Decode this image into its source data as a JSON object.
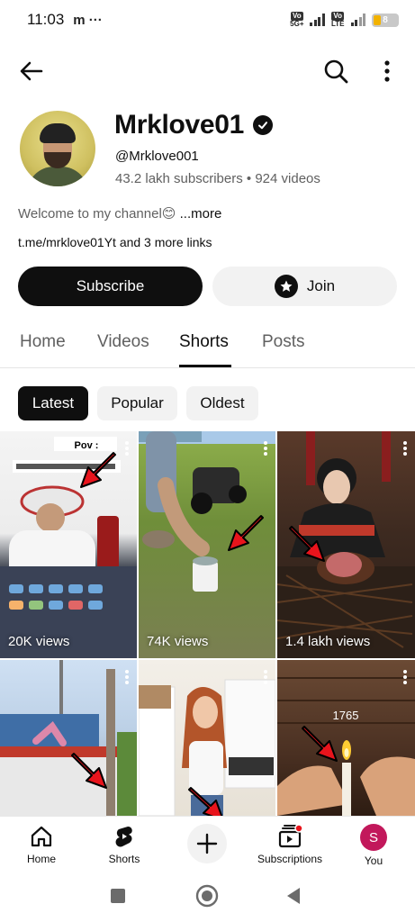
{
  "status_bar": {
    "time": "11:03",
    "left_icons": [
      "messaging-m-icon",
      "more-dots-icon"
    ],
    "left_text": "m ···",
    "network": [
      {
        "top": "Vo",
        "bottom": "5G+"
      },
      {
        "top": "Vo",
        "bottom": "LTE"
      }
    ],
    "battery": "8"
  },
  "appbar": {
    "back_icon": "back-arrow-icon",
    "search_icon": "search-icon",
    "more_icon": "more-vert-icon"
  },
  "channel": {
    "name": "Mrklove01",
    "handle": "@Mrklove001",
    "meta": "43.2 lakh subscribers • 924 videos",
    "description": "Welcome to my channel😊 ",
    "more": "...more",
    "links": "t.me/mrklove01Yt and 3 more links",
    "subscribe_label": "Subscribe",
    "join_label": "Join"
  },
  "tabs": [
    {
      "label": "Home"
    },
    {
      "label": "Videos"
    },
    {
      "label": "Shorts"
    },
    {
      "label": "Posts"
    }
  ],
  "active_tab": "Shorts",
  "chips": [
    {
      "label": "Latest"
    },
    {
      "label": "Popular"
    },
    {
      "label": "Oldest"
    }
  ],
  "shorts": [
    {
      "views": "20K views",
      "overlay_text": "Pov :"
    },
    {
      "views": "74K views"
    },
    {
      "views": "1.4 lakh views"
    },
    {
      "views": ""
    },
    {
      "views": ""
    },
    {
      "views": "",
      "overlay_text": "1765"
    }
  ],
  "bottom_nav": [
    {
      "label": "Home",
      "icon": "home-icon"
    },
    {
      "label": "Shorts",
      "icon": "shorts-icon"
    },
    {
      "label": "",
      "icon": "create-plus-icon"
    },
    {
      "label": "Subscriptions",
      "icon": "subscriptions-icon"
    },
    {
      "label": "You",
      "icon": "avatar",
      "avatar_letter": "S"
    }
  ],
  "colors": {
    "accent": "#0f0f0f",
    "subtext": "#606060",
    "arrow_red": "#e8141c",
    "you_avatar": "#c2185b",
    "notification_dot": "#e8141c"
  }
}
